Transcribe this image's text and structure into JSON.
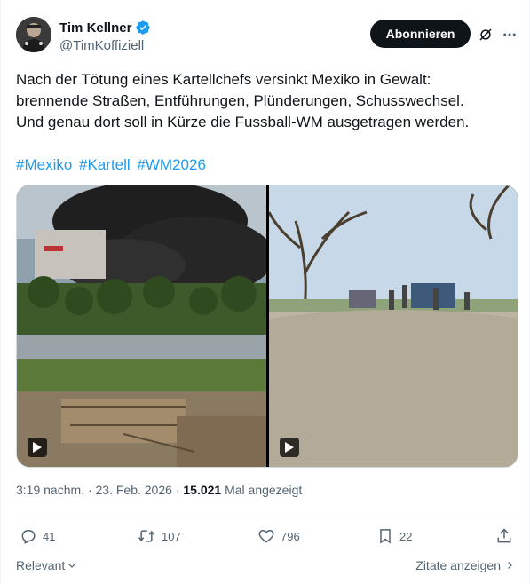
{
  "author": {
    "display_name": "Tim Kellner",
    "handle": "@TimKoffiziell",
    "verified": true
  },
  "header": {
    "follow_label": "Abonnieren",
    "grok_icon": "grok-slash-icon",
    "more_icon": "more-dots-icon"
  },
  "tweet": {
    "lines": [
      "Nach der Tötung eines Kartellchefs versinkt Mexiko in Gewalt:",
      "brennende Straßen, Entführungen, Plünderungen, Schusswechsel.",
      "Und genau dort soll in Kürze die Fussball-WM ausgetragen werden."
    ],
    "hashtags": [
      "#Mexiko",
      "#Kartell",
      "#WM2026"
    ]
  },
  "media": {
    "videos": [
      {
        "description_icon": "play-icon"
      },
      {
        "description_icon": "play-icon"
      }
    ]
  },
  "meta": {
    "time": "3:19 nachm.",
    "date": "23. Feb. 2026",
    "views_count": "15.021",
    "views_label": "Mal angezeigt"
  },
  "actions": {
    "replies": "41",
    "reposts": "107",
    "likes": "796",
    "bookmarks": "22"
  },
  "footer": {
    "sort_label": "Relevant",
    "quotes_label": "Zitate anzeigen"
  },
  "colors": {
    "link": "#1d9bf0",
    "secondary_text": "#536471",
    "primary_text": "#0f1419",
    "verified": "#1d9bf0"
  }
}
